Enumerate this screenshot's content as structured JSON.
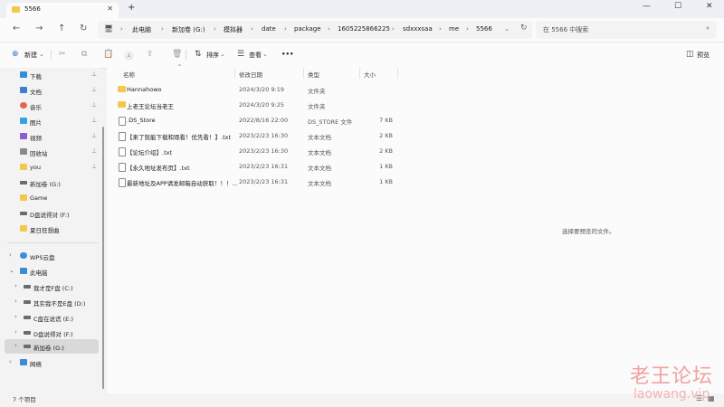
{
  "window": {
    "tab_title": "5566",
    "tab_close": "✕",
    "new_tab": "+",
    "minimize": "—",
    "maximize": "☐",
    "close": "✕"
  },
  "nav": {
    "back": "←",
    "forward": "→",
    "up": "↑",
    "refresh": "↻"
  },
  "breadcrumb": [
    "此电脑",
    "新加卷 (G:)",
    "模拟器",
    "date",
    "package",
    "1605225866225",
    "sdxxxsaa",
    "me",
    "5566"
  ],
  "search": {
    "placeholder": "在 5566 中搜索"
  },
  "toolbar": {
    "new_label": "新建",
    "sort_label": "排序",
    "view_label": "查看",
    "more_label": "•••",
    "preview_label": "预览"
  },
  "sidebar": {
    "quick": [
      {
        "label": "下载",
        "color": "#2f8fdb"
      },
      {
        "label": "文档",
        "color": "#3c7fd1"
      },
      {
        "label": "音乐",
        "color": "#e0664f"
      },
      {
        "label": "图片",
        "color": "#3aa0e6"
      },
      {
        "label": "视频",
        "color": "#8b5cd6"
      },
      {
        "label": "回收站",
        "color": "#8a8a8a"
      },
      {
        "label": "you",
        "color": "#f2c94c"
      },
      {
        "label": "新加卷 (G:)",
        "color": "#6b6b6b"
      },
      {
        "label": "Game",
        "color": "#f2c94c"
      },
      {
        "label": "D盘说得对 (F:)",
        "color": "#6b6b6b"
      },
      {
        "label": "夏日狂想曲",
        "color": "#f2c94c"
      }
    ],
    "pin": "📌",
    "cloud": "WPS云盘",
    "pc": "此电脑",
    "drives": [
      "我才是F盘 (C:)",
      "其实我不是E盘 (D:)",
      "C盘在说谎 (E:)",
      "D盘说得对 (F:)",
      "新加卷 (G:)"
    ],
    "network": "网络"
  },
  "columns": {
    "name": "名称",
    "date": "修改日期",
    "type": "类型",
    "size": "大小"
  },
  "files": [
    {
      "name": "Hannahowo",
      "date": "2024/3/20 9:19",
      "type": "文件夹",
      "size": "",
      "kind": "folder"
    },
    {
      "name": "上老王论坛当老王",
      "date": "2024/3/20 9:25",
      "type": "文件夹",
      "size": "",
      "kind": "folder"
    },
    {
      "name": ".DS_Store",
      "date": "2022/8/16 22:00",
      "type": "DS_STORE 文件",
      "size": "7 KB",
      "kind": "doc"
    },
    {
      "name": "【来了就能下载和观看！优先看！】.txt",
      "date": "2023/2/23 16:30",
      "type": "文本文档",
      "size": "2 KB",
      "kind": "doc"
    },
    {
      "name": "【论坛介绍】.txt",
      "date": "2023/2/23 16:30",
      "type": "文本文档",
      "size": "2 KB",
      "kind": "doc"
    },
    {
      "name": "【永久地址发布页】.txt",
      "date": "2023/2/23 16:31",
      "type": "文本文档",
      "size": "1 KB",
      "kind": "doc"
    },
    {
      "name": "最新地址及APP请发邮箱自动获取！！！...",
      "date": "2023/2/23 16:31",
      "type": "文本文档",
      "size": "1 KB",
      "kind": "doc"
    }
  ],
  "preview_hint": "选择要预览的文件。",
  "status": {
    "count": "7 个项目"
  },
  "watermark": {
    "line1": "老王论坛",
    "line2": "laowang.vip"
  }
}
